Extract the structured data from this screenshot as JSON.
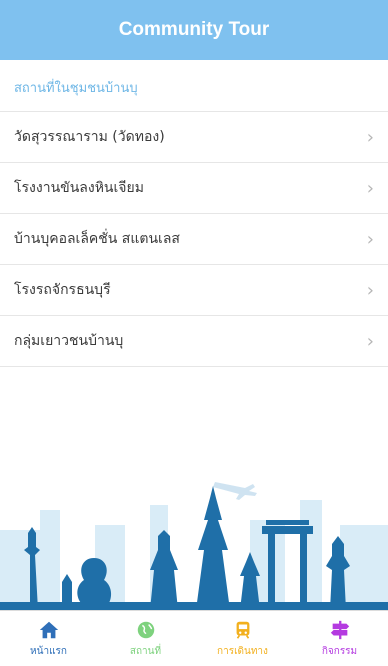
{
  "header": {
    "title": "Community Tour"
  },
  "section": {
    "title": "สถานที่ในชุมชนบ้านบุ"
  },
  "places": [
    {
      "label": "วัดสุวรรณาราม (วัดทอง)"
    },
    {
      "label": "โรงงานขันลงหินเจียม"
    },
    {
      "label": "บ้านบุคอลเล็คชั่น สแตนเลส"
    },
    {
      "label": "โรงรถจักรธนบุรี"
    },
    {
      "label": "กลุ่มเยาวชนบ้านบุ"
    }
  ],
  "tabs": [
    {
      "label": "หน้าแรก",
      "icon": "home-icon",
      "color": "#2f6fb8"
    },
    {
      "label": "สถานที่",
      "icon": "globe-icon",
      "color": "#7ed27e"
    },
    {
      "label": "การเดินทาง",
      "icon": "train-icon",
      "color": "#f2b01e"
    },
    {
      "label": "กิจกรรม",
      "icon": "signpost-icon",
      "color": "#b43ae0"
    }
  ],
  "colors": {
    "header": "#7fc1ef",
    "skyline": "#1f6fa8"
  }
}
